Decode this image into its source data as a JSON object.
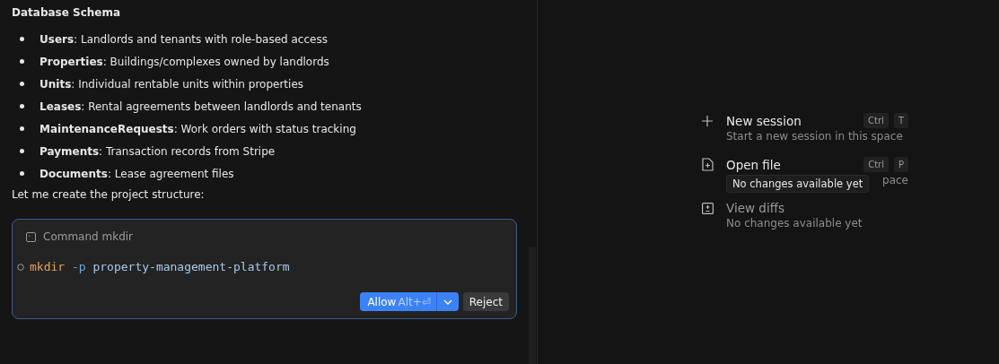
{
  "chat": {
    "heading": "Database Schema",
    "items": [
      {
        "term": "Users",
        "text": ": Landlords and tenants with role-based access"
      },
      {
        "term": "Properties",
        "text": ": Buildings/complexes owned by landlords"
      },
      {
        "term": "Units",
        "text": ": Individual rentable units within properties"
      },
      {
        "term": "Leases",
        "text": ": Rental agreements between landlords and tenants"
      },
      {
        "term": "MaintenanceRequests",
        "text": ": Work orders with status tracking"
      },
      {
        "term": "Payments",
        "text": ": Transaction records from Stripe"
      },
      {
        "term": "Documents",
        "text": ": Lease agreement files"
      }
    ],
    "closing": "Let me create the project structure:"
  },
  "command_card": {
    "title": "Command mkdir",
    "command": "mkdir",
    "flag": "-p",
    "argument": "property-management-platform",
    "allow_button": "Allow",
    "allow_shortcut": "Alt+⏎",
    "reject_button": "Reject"
  },
  "actions": [
    {
      "kind": "new",
      "label": "New session",
      "keys": [
        "Ctrl",
        "T"
      ],
      "description": "Start a new session in this space",
      "disabled": false
    },
    {
      "kind": "open",
      "label": "Open file",
      "keys": [
        "Ctrl",
        "P"
      ],
      "description_end": "pace",
      "disabled": false
    },
    {
      "kind": "diff",
      "label": "View diffs",
      "description": "No changes available yet",
      "disabled": true
    }
  ],
  "tooltip": "No changes available yet"
}
